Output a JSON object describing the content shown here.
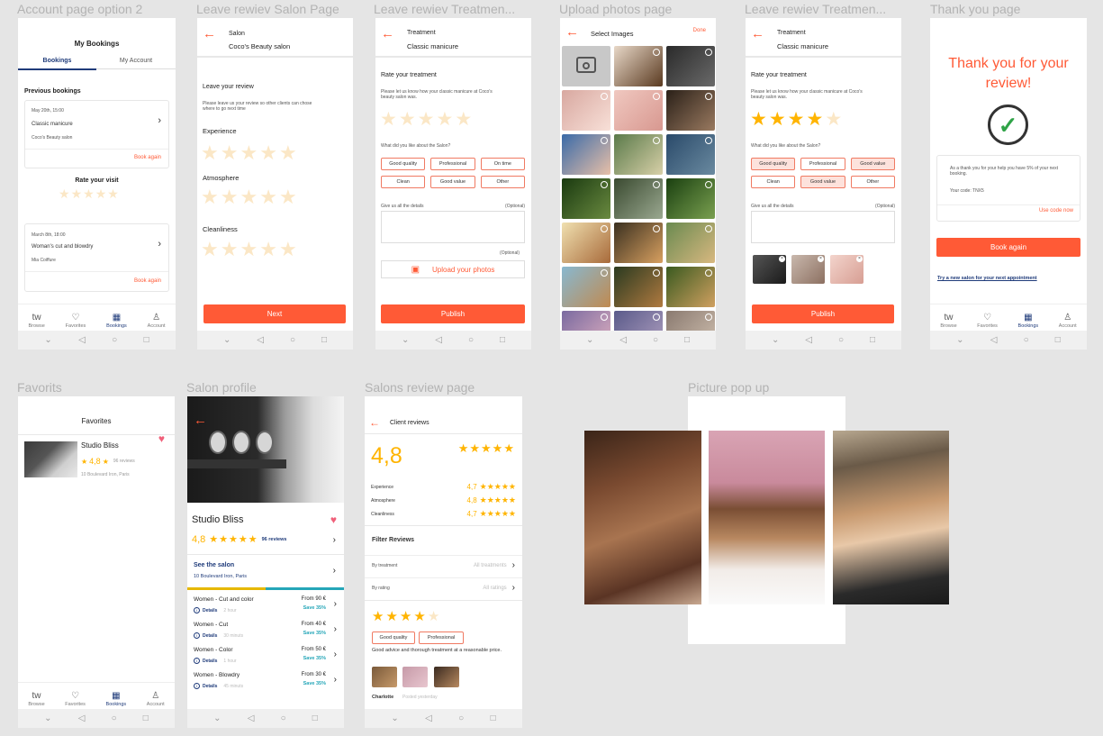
{
  "labels": {
    "s1": "Account page option 2",
    "s2": "Leave rewiev Salon Page",
    "s3": "Leave rewiev Treatmen...",
    "s4": "Upload photos page",
    "s5": "Leave rewiev Treatmen...",
    "s6": "Thank you page",
    "s7": "Favorits",
    "s8": "Salon profile",
    "s9": "Salons review page",
    "s10": "Picture pop up"
  },
  "nav": {
    "browse": "Browse",
    "favorites": "Favorites",
    "bookings": "Bookings",
    "account": "Account",
    "tw": "tw"
  },
  "s1": {
    "title": "My Bookings",
    "tab1": "Bookings",
    "tab2": "My Account",
    "section": "Previous bookings",
    "b1": {
      "date": "May 20th, 15:00",
      "name": "Classic manicure",
      "salon": "Coco's Beauty salon",
      "action": "Book again"
    },
    "rate": "Rate your visit",
    "b2": {
      "date": "March 8th, 18:00",
      "name": "Woman's cut and blowdry",
      "salon": "Mia Coiffure",
      "action": "Book again"
    }
  },
  "s2": {
    "kicker": "Salon",
    "name": "Coco's Beauty salon",
    "heading": "Leave your review",
    "desc": "Please leave us your review so other clients can chose where to go next time",
    "c1": "Experience",
    "c2": "Atmosphere",
    "c3": "Cleanliness",
    "btn": "Next"
  },
  "s3": {
    "kicker": "Treatment",
    "name": "Classic manicure",
    "heading": "Rate your treatment",
    "desc": "Please let us know how your classic manicure at Coco's beauty salon was.",
    "question": "What did you like about the Salon?",
    "chips": [
      "Good quality",
      "Professional",
      "On time",
      "Clean",
      "Good value",
      "Other"
    ],
    "details": "Give us all the details",
    "optional": "(Optional)",
    "optional2": "(Optional)",
    "upload": "Upload your photos",
    "btn": "Publish"
  },
  "s4": {
    "title": "Select Images",
    "done": "Done"
  },
  "s5": {
    "kicker": "Treatment",
    "name": "Classic manicure",
    "heading": "Rate your treatment",
    "desc": "Please let us know how your classic manicure at Coco's beauty salon was.",
    "question": "What did you like about the Salon?",
    "chips": [
      "Good quality",
      "Professional",
      "Good value",
      "Clean",
      "Good value",
      "Other"
    ],
    "details": "Give us all the details",
    "optional": "(Optional)",
    "btn": "Publish",
    "rating": 4
  },
  "s6": {
    "title": "Thank you for your review!",
    "msg": "As a thank you for your help you have 5% of your next booking.",
    "code": "Your code: TNX5",
    "use": "Use code now",
    "btn": "Book again",
    "link": "Try a new salon for your next appointment"
  },
  "s7": {
    "title": "Favorites",
    "salon": "Studio Bliss",
    "rating": "4,8",
    "reviews": "96 reviews",
    "address": "10 Boulevard Iron, Paris"
  },
  "s8": {
    "salon": "Studio Bliss",
    "rating": "4,8",
    "reviews": "96 reviews",
    "see": "See the salon",
    "address": "10 Boulevard Iron, Paris",
    "details": "Details",
    "services": [
      {
        "name": "Women - Cut and color",
        "price": "From 90 €",
        "save": "Save 35%",
        "dur": "2 hour"
      },
      {
        "name": "Women - Cut",
        "price": "From 40 €",
        "save": "Save 35%",
        "dur": "30 minuts"
      },
      {
        "name": "Women - Color",
        "price": "From 50 €",
        "save": "Save 35%",
        "dur": "1 hour"
      },
      {
        "name": "Women - Blowdry",
        "price": "From 30 €",
        "save": "Save 35%",
        "dur": "45 minuts"
      }
    ]
  },
  "s9": {
    "title": "Client reviews",
    "overall": "4,8",
    "c1": "Experience",
    "v1": "4,7",
    "c2": "Atmosphere",
    "v2": "4,8",
    "c3": "Cleanliness",
    "v3": "4,7",
    "filter": "Filter Reviews",
    "f1": "By treatment",
    "f1v": "All treatments",
    "f2": "By rating",
    "f2v": "All ratings",
    "chip1": "Good quality",
    "chip2": "Professional",
    "review": "Good advice and thorough treatment at a reasonable price.",
    "author": "Charlotte",
    "posted": "Posted yesterday",
    "rating": 4
  }
}
